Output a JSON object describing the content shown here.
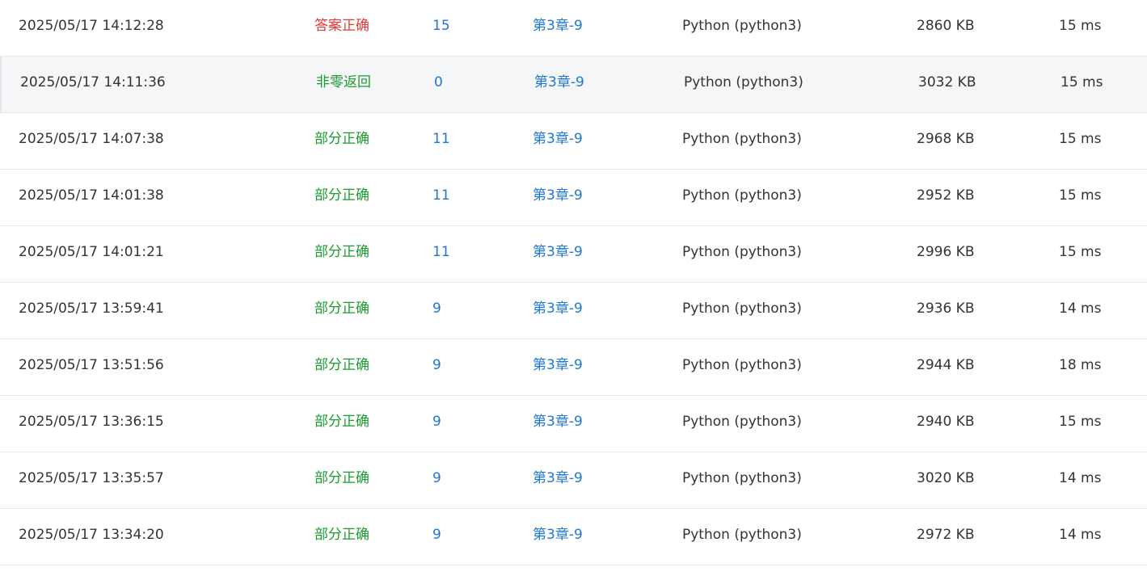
{
  "colors": {
    "link": "#1e78d2",
    "status_red": "#e53935",
    "status_green": "#1a9c2f",
    "text": "#333333",
    "hover_row_bg": "#f5f6f8"
  },
  "submissions": [
    {
      "time": "2025/05/17 14:12:28",
      "status": "答案正确",
      "score": "15",
      "problem": "第3章-9",
      "language": "Python (python3)",
      "memory": "2860 KB",
      "duration": "15 ms"
    },
    {
      "time": "2025/05/17 14:11:36",
      "status": "非零返回",
      "score": "0",
      "problem": "第3章-9",
      "language": "Python (python3)",
      "memory": "3032 KB",
      "duration": "15 ms"
    },
    {
      "time": "2025/05/17 14:07:38",
      "status": "部分正确",
      "score": "11",
      "problem": "第3章-9",
      "language": "Python (python3)",
      "memory": "2968 KB",
      "duration": "15 ms"
    },
    {
      "time": "2025/05/17 14:01:38",
      "status": "部分正确",
      "score": "11",
      "problem": "第3章-9",
      "language": "Python (python3)",
      "memory": "2952 KB",
      "duration": "15 ms"
    },
    {
      "time": "2025/05/17 14:01:21",
      "status": "部分正确",
      "score": "11",
      "problem": "第3章-9",
      "language": "Python (python3)",
      "memory": "2996 KB",
      "duration": "15 ms"
    },
    {
      "time": "2025/05/17 13:59:41",
      "status": "部分正确",
      "score": "9",
      "problem": "第3章-9",
      "language": "Python (python3)",
      "memory": "2936 KB",
      "duration": "14 ms"
    },
    {
      "time": "2025/05/17 13:51:56",
      "status": "部分正确",
      "score": "9",
      "problem": "第3章-9",
      "language": "Python (python3)",
      "memory": "2944 KB",
      "duration": "18 ms"
    },
    {
      "time": "2025/05/17 13:36:15",
      "status": "部分正确",
      "score": "9",
      "problem": "第3章-9",
      "language": "Python (python3)",
      "memory": "2940 KB",
      "duration": "15 ms"
    },
    {
      "time": "2025/05/17 13:35:57",
      "status": "部分正确",
      "score": "9",
      "problem": "第3章-9",
      "language": "Python (python3)",
      "memory": "3020 KB",
      "duration": "14 ms"
    },
    {
      "time": "2025/05/17 13:34:20",
      "status": "部分正确",
      "score": "9",
      "problem": "第3章-9",
      "language": "Python (python3)",
      "memory": "2972 KB",
      "duration": "14 ms"
    }
  ]
}
